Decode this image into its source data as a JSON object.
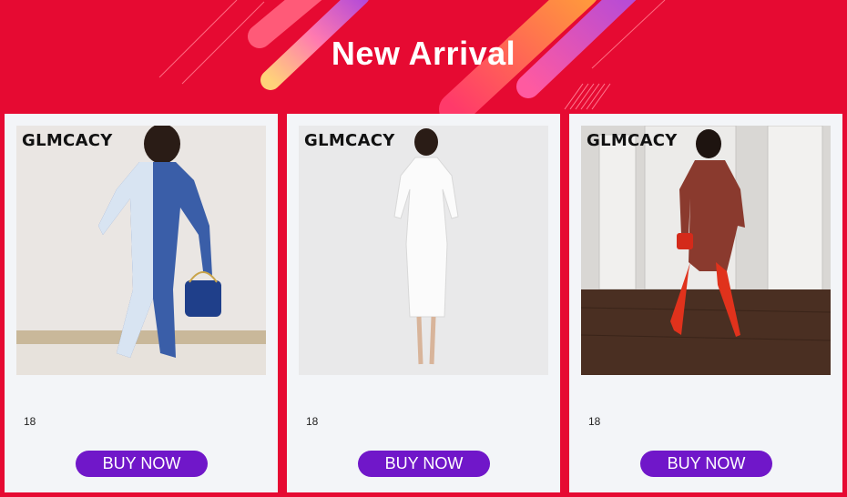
{
  "banner": {
    "title": "New Arrival",
    "colors": {
      "background": "#e60a32",
      "accent_orange": "#ff9a3c",
      "accent_purple": "#b44bd8",
      "accent_pink": "#ff6fa0"
    }
  },
  "products": [
    {
      "brand": "GLMCACY",
      "price": "18",
      "button_label": "BUY NOW",
      "image": "woman in blue and white tie-dye zip jumpsuit with quilted handbag"
    },
    {
      "brand": "GLMCACY",
      "price": "18",
      "button_label": "BUY NOW",
      "image": "woman in white ribbed long-sleeve midi bodycon dress"
    },
    {
      "brand": "GLMCACY",
      "price": "18",
      "button_label": "BUY NOW",
      "image": "woman in red patterned zip jumpsuit with red thigh-high boots"
    }
  ],
  "colors": {
    "card_bg": "#f3f5f8",
    "button": "#7017c9",
    "button_text": "#ffffff"
  }
}
